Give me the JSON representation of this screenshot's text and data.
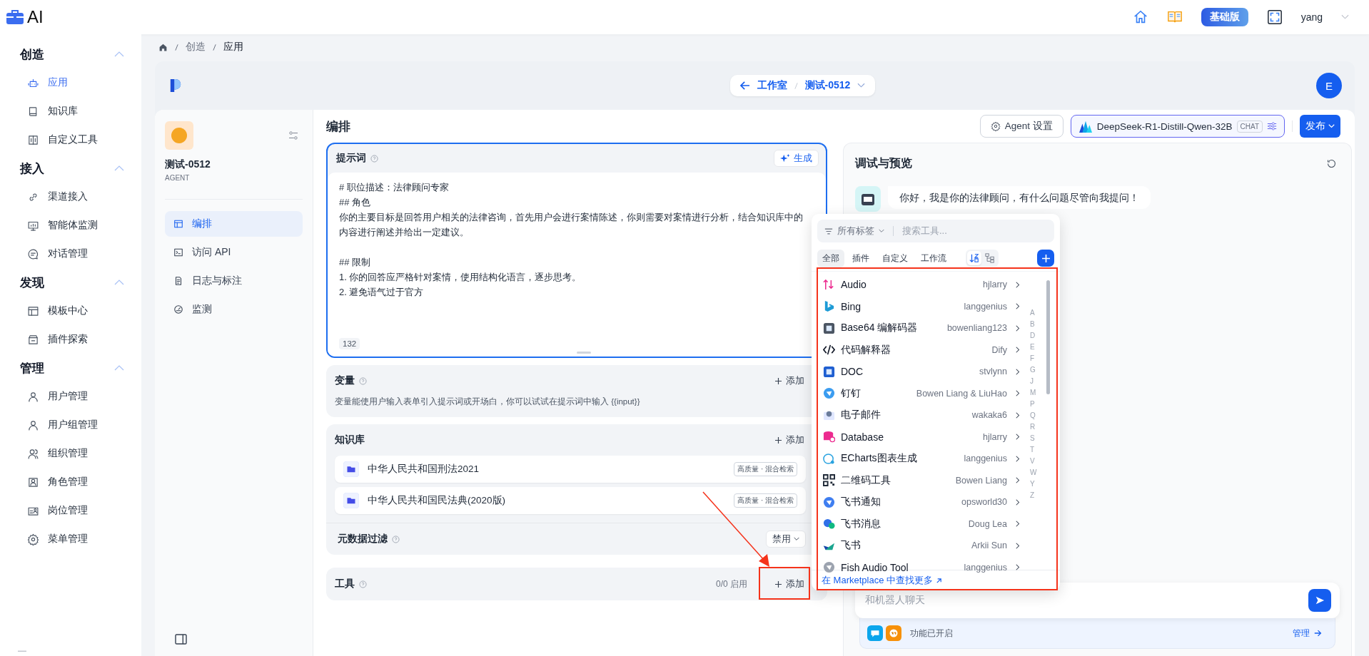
{
  "header": {
    "logo": "AI",
    "edition_badge": "基础版",
    "user": "yang"
  },
  "sidebar": {
    "groups": [
      {
        "title": "创造",
        "expanded": true,
        "items": [
          {
            "label": "应用",
            "selected": true
          },
          {
            "label": "知识库",
            "selected": false
          },
          {
            "label": "自定义工具",
            "selected": false
          }
        ]
      },
      {
        "title": "接入",
        "expanded": true,
        "items": [
          {
            "label": "渠道接入",
            "selected": false
          },
          {
            "label": "智能体监测",
            "selected": false
          },
          {
            "label": "对话管理",
            "selected": false
          }
        ]
      },
      {
        "title": "发现",
        "expanded": true,
        "items": [
          {
            "label": "模板中心",
            "selected": false
          },
          {
            "label": "插件探索",
            "selected": false
          }
        ]
      },
      {
        "title": "管理",
        "expanded": true,
        "items": [
          {
            "label": "用户管理",
            "selected": false
          },
          {
            "label": "用户组管理",
            "selected": false
          },
          {
            "label": "组织管理",
            "selected": false
          },
          {
            "label": "角色管理",
            "selected": false
          },
          {
            "label": "岗位管理",
            "selected": false
          },
          {
            "label": "菜单管理",
            "selected": false
          }
        ]
      }
    ]
  },
  "breadcrumb": [
    "创造",
    "应用"
  ],
  "app_bar": {
    "back_label": "工作室",
    "app_name": "测试-0512",
    "avatar": "E"
  },
  "app_panel": {
    "name": "测试-0512",
    "type": "AGENT",
    "nav": [
      {
        "label": "编排",
        "selected": true
      },
      {
        "label": "访问 API",
        "selected": false
      },
      {
        "label": "日志与标注",
        "selected": false
      },
      {
        "label": "监测",
        "selected": false
      }
    ]
  },
  "toolbar": {
    "agent_settings": "Agent 设置",
    "model": "DeepSeek-R1-Distill-Qwen-32B",
    "model_tag": "CHAT",
    "publish": "发布"
  },
  "editor": {
    "title": "编排",
    "prompt": {
      "label": "提示词",
      "generate": "生成",
      "blocks": [
        [
          "# 职位描述：法律顾问专家",
          "## 角色",
          "你的主要目标是回答用户相关的法律咨询，首先用户会进行案情陈述，你则需要对案情进行分析，结合知识库中的内容进行阐述并给出一定建议。"
        ],
        [
          "## 限制",
          "1. 你的回答应严格针对案情，使用结构化语言，逐步思考。",
          "2. 避免语气过于官方"
        ]
      ],
      "count": "132"
    },
    "variables": {
      "label": "变量",
      "add": "添加",
      "hint": "变量能使用户输入表单引入提示词或开场白，你可以试试在提示词中输入 {{input}}"
    },
    "knowledge": {
      "label": "知识库",
      "add": "添加",
      "items": [
        {
          "name": "中华人民共和国刑法2021",
          "tag": "高质量 · 混合检索"
        },
        {
          "name": "中华人民共和国民法典(2020版)",
          "tag": "高质量 · 混合检索"
        }
      ],
      "metadata_filter": {
        "label": "元数据过滤",
        "value": "禁用"
      }
    },
    "tools": {
      "label": "工具",
      "count": "0/0 启用",
      "add": "添加"
    }
  },
  "preview": {
    "title": "调试与预览",
    "message": "你好，我是你的法律顾问，有什么问题尽管向我提问！",
    "input_placeholder": "和机器人聊天",
    "features": "功能已开启",
    "manage": "管理"
  },
  "tool_picker": {
    "filter": "所有标签",
    "search_placeholder": "搜索工具...",
    "tabs": [
      {
        "label": "全部",
        "selected": true
      },
      {
        "label": "插件",
        "selected": false
      },
      {
        "label": "自定义",
        "selected": false
      },
      {
        "label": "工作流",
        "selected": false
      }
    ],
    "view_modes": [
      {
        "kind": "sort",
        "selected": true
      },
      {
        "kind": "tree",
        "selected": false
      }
    ],
    "tools": [
      {
        "name": "Audio",
        "author": "hjlarry"
      },
      {
        "name": "Bing",
        "author": "langgenius"
      },
      {
        "name": "Base64 编解码器",
        "author": "bowenliang123"
      },
      {
        "name": "代码解释器",
        "author": "Dify"
      },
      {
        "name": "DOC",
        "author": "stvlynn"
      },
      {
        "name": "钉钉",
        "author": "Bowen Liang & LiuHao"
      },
      {
        "name": "电子邮件",
        "author": "wakaka6"
      },
      {
        "name": "Database",
        "author": "hjlarry"
      },
      {
        "name": "ECharts图表生成",
        "author": "langgenius"
      },
      {
        "name": "二维码工具",
        "author": "Bowen Liang"
      },
      {
        "name": "飞书通知",
        "author": "opsworld30"
      },
      {
        "name": "飞书消息",
        "author": "Doug Lea"
      },
      {
        "name": "飞书",
        "author": "Arkii Sun"
      },
      {
        "name": "Fish Audio Tool",
        "author": "langgenius"
      }
    ],
    "index": [
      "A",
      "B",
      "D",
      "E",
      "F",
      "G",
      "J",
      "M",
      "P",
      "Q",
      "R",
      "S",
      "T",
      "V",
      "W",
      "Y",
      "Z"
    ],
    "marketplace_link": "在 Marketplace 中查找更多"
  }
}
